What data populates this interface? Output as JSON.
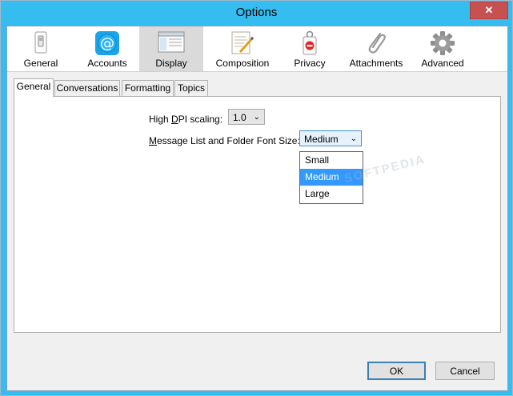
{
  "window": {
    "title": "Options",
    "close_glyph": "✕"
  },
  "toolbar": {
    "items": [
      {
        "label": "General",
        "icon": "switch-icon"
      },
      {
        "label": "Accounts",
        "icon": "at-sign-icon"
      },
      {
        "label": "Display",
        "icon": "window-layout-icon",
        "selected": true
      },
      {
        "label": "Composition",
        "icon": "pen-and-paper-icon"
      },
      {
        "label": "Privacy",
        "icon": "do-not-disturb-tag-icon"
      },
      {
        "label": "Attachments",
        "icon": "paperclip-icon"
      },
      {
        "label": "Advanced",
        "icon": "gear-icon"
      }
    ]
  },
  "tabs": [
    {
      "label": "General",
      "active": true
    },
    {
      "label": "Conversations"
    },
    {
      "label": "Formatting"
    },
    {
      "label": "Topics"
    }
  ],
  "settings": {
    "dpi_label_pre": "High ",
    "dpi_label_ul": "D",
    "dpi_label_post": "PI scaling:",
    "dpi_value": "1.0",
    "font_label_ul": "M",
    "font_label_post": "essage List and Folder Font Size:",
    "font_value": "Medium",
    "font_options": [
      "Small",
      "Medium",
      "Large"
    ],
    "font_selected": "Medium"
  },
  "watermark": "SOFTPEDIA",
  "buttons": {
    "ok": "OK",
    "cancel": "Cancel"
  },
  "colors": {
    "title_bar": "#36bdf0",
    "selection": "#3399ff",
    "close_button": "#c75050"
  }
}
